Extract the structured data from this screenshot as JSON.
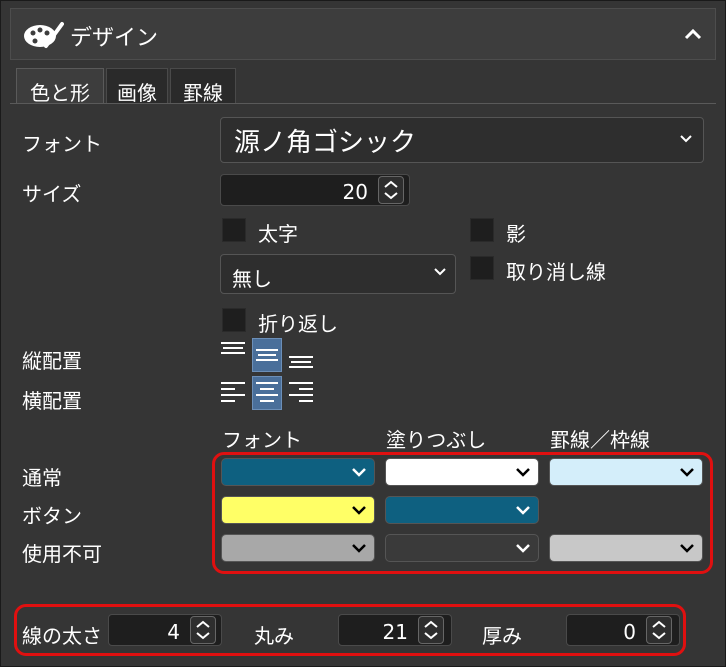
{
  "header": {
    "title": "デザイン",
    "icon": "palette-icon"
  },
  "tabs": [
    {
      "label": "色と形",
      "active": true
    },
    {
      "label": "画像",
      "active": false
    },
    {
      "label": "罫線",
      "active": false
    }
  ],
  "font": {
    "label": "フォント",
    "value": "源ノ角ゴシック"
  },
  "size": {
    "label": "サイズ",
    "value": "20"
  },
  "checkboxes": {
    "bold": "太字",
    "shadow": "影",
    "strike": "取り消し線",
    "wrap": "折り返し"
  },
  "decoration": {
    "value": "無し"
  },
  "valign": {
    "label": "縦配置",
    "selected": "center"
  },
  "halign": {
    "label": "横配置",
    "selected": "center"
  },
  "color_headers": {
    "font": "フォント",
    "fill": "塗りつぶし",
    "border": "罫線／枠線"
  },
  "color_rows": {
    "normal": {
      "label": "通常",
      "font": "#0e6080",
      "fill": "#ffffff",
      "border": "#d4eefa"
    },
    "button": {
      "label": "ボタン",
      "font": "#ffff66",
      "fill": "#0e6080"
    },
    "disabled": {
      "label": "使用不可",
      "font": "#a8a8a8",
      "fill": "#3a3a3a",
      "border": "#c8c8c8"
    }
  },
  "line": {
    "width_label": "線の太さ",
    "width_value": "4",
    "round_label": "丸み",
    "round_value": "21",
    "depth_label": "厚み",
    "depth_value": "0"
  },
  "accent_colors": {
    "highlight": "#e01010",
    "selected_align": "#4a6f9a"
  }
}
